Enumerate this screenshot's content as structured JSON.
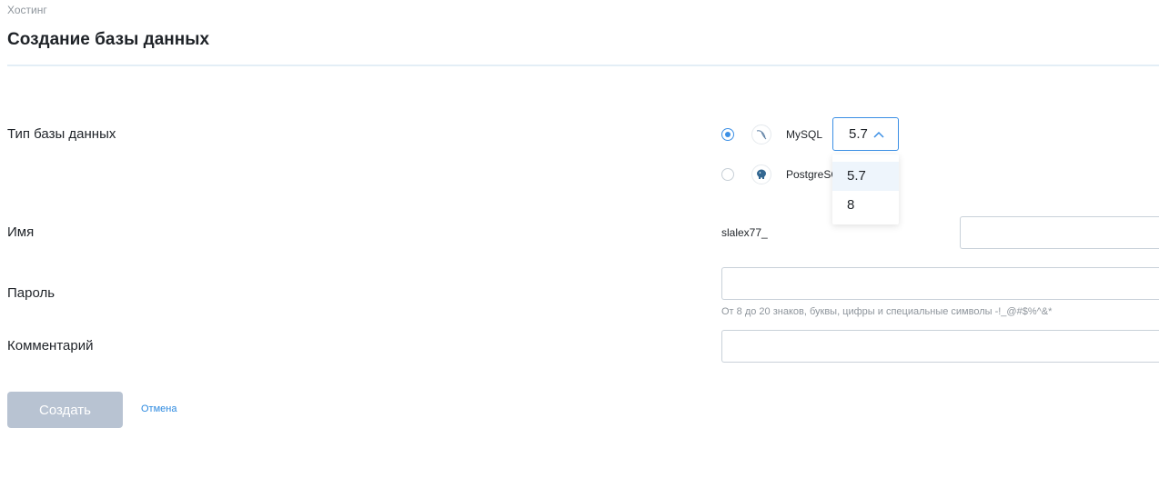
{
  "breadcrumb": "Хостинг",
  "title": "Создание базы данных",
  "form": {
    "db_type_label": "Тип базы данных",
    "name_label": "Имя",
    "password_label": "Пароль",
    "comment_label": "Комментарий",
    "db_types": [
      {
        "name": "MySQL",
        "selected": true,
        "icon": "mysql-dolphin-icon"
      },
      {
        "name": "PostgreSQL",
        "selected": false,
        "icon": "postgresql-elephant-icon"
      }
    ],
    "version": {
      "value": "5.7",
      "options": [
        "5.7",
        "8"
      ],
      "open": true
    },
    "name_prefix": "slalex77_",
    "name_value": "",
    "password_value": "",
    "password_hint": "От 8 до 20 знаков, буквы, цифры и специальные символы -!_@#$%^&*",
    "comment_value": ""
  },
  "actions": {
    "create_label": "Создать",
    "cancel_label": "Отмена"
  },
  "colors": {
    "accent": "#3b8fe5",
    "link": "#2d8ae0",
    "disabled_button": "#b8c3d2",
    "divider": "#e3eef6"
  }
}
